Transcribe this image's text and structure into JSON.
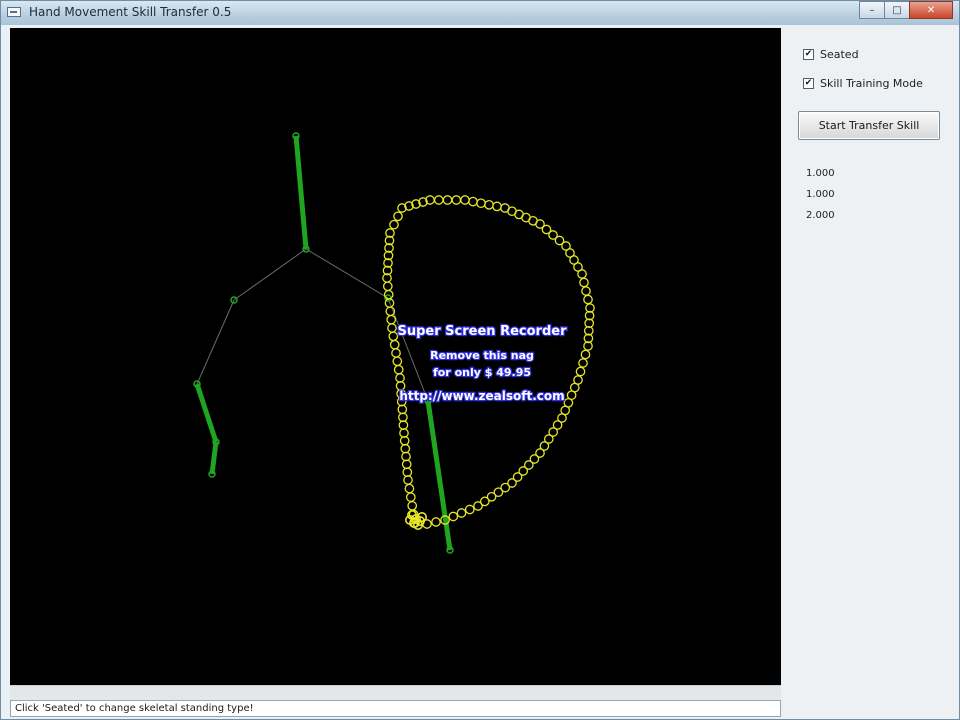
{
  "window": {
    "title": "Hand Movement Skill Transfer 0.5",
    "controls": {
      "minimize": "–",
      "maximize": "□",
      "close": "✕"
    }
  },
  "panel": {
    "checkbox_seated": {
      "label": "Seated",
      "checked": true
    },
    "checkbox_training": {
      "label": "Skill Training Mode",
      "checked": true
    },
    "start_button_label": "Start Transfer Skill",
    "values": [
      "1.000",
      "1.000",
      "2.000"
    ]
  },
  "watermark": {
    "line1": "Super Screen Recorder",
    "line2": "Remove this nag",
    "line3": "for only $ 49.95",
    "line4": "http://www.zealsoft.com"
  },
  "status": {
    "text": "Click 'Seated' to change skeletal standing type!"
  },
  "colors": {
    "canvas_bg": "#000000",
    "skeleton_limb": "#1fa51f",
    "skeleton_bone": "#6b6b6b",
    "trajectory": "#e6e62a",
    "watermark_text": "#ffffff",
    "watermark_glow": "#2f2fe0"
  },
  "icons": {
    "app": "app-window-icon",
    "minimize": "minimize-icon",
    "maximize": "maximize-icon",
    "close": "close-icon"
  }
}
